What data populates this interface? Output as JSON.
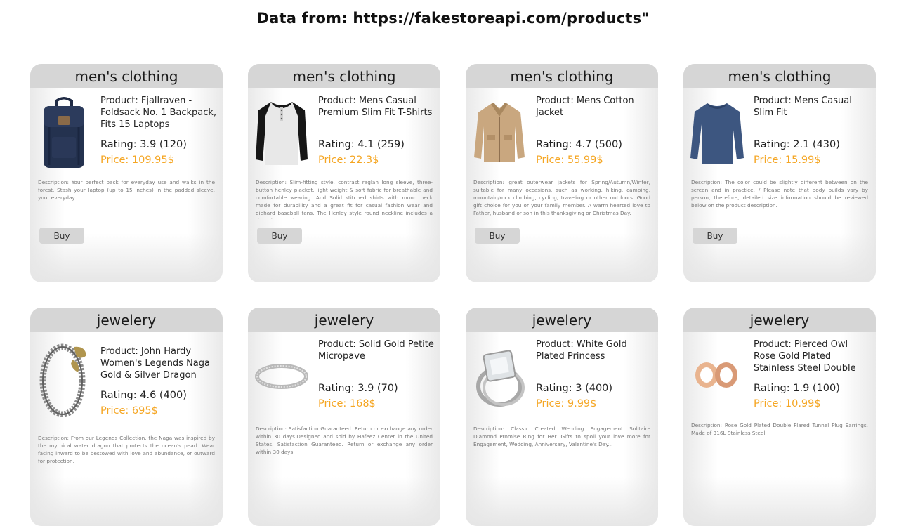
{
  "title": "Data from: https://fakestoreapi.com/products\"",
  "buy_label": "Buy",
  "products": [
    {
      "category": "men's clothing",
      "product": "Product: Fjallraven - Foldsack No. 1 Backpack, Fits 15 Laptops",
      "rating": "Rating: 3.9 (120)",
      "price": "Price: 109.95$",
      "description": "Description: Your perfect pack for everyday use and walks in the forest. Stash your laptop (up to 15 inches) in the padded sleeve, your everyday",
      "image_icon": "backpack-image"
    },
    {
      "category": "men's clothing",
      "product": "Product: Mens Casual Premium Slim Fit T-Shirts",
      "rating": "Rating: 4.1 (259)",
      "price": "Price: 22.3$",
      "description": "Description: Slim-fitting style, contrast raglan long sleeve, three-button henley placket, light weight & soft fabric for breathable and comfortable wearing. And Solid stitched shirts with round neck made for durability and a great fit for casual fashion wear and diehard baseball fans. The Henley style round neckline includes a three-button placket.",
      "image_icon": "henley-shirt-image"
    },
    {
      "category": "men's clothing",
      "product": "Product: Mens Cotton Jacket",
      "rating": "Rating: 4.7 (500)",
      "price": "Price: 55.99$",
      "description": "Description: great outerwear jackets for Spring/Autumn/Winter, suitable for many occasions, such as working, hiking, camping, mountain/rock climbing, cycling, traveling or other outdoors. Good gift choice for you or your family member. A warm hearted love to Father, husband or son in this thanksgiving or Christmas Day.",
      "image_icon": "jacket-image"
    },
    {
      "category": "men's clothing",
      "product": "Product: Mens Casual Slim Fit",
      "rating": "Rating: 2.1 (430)",
      "price": "Price: 15.99$",
      "description": "Description: The color could be slightly different between on the screen and in practice. / Please note that body builds vary by person, therefore, detailed size information should be reviewed below on the product description.",
      "image_icon": "long-sleeve-shirt-image"
    },
    {
      "category": "jewelery",
      "product": "Product: John Hardy Women's Legends Naga Gold & Silver Dragon",
      "rating": "Rating: 4.6 (400)",
      "price": "Price: 695$",
      "description": "Description: From our Legends Collection, the Naga was inspired by the mythical water dragon that protects the ocean's pearl. Wear facing inward to be bestowed with love and abundance, or outward for protection.",
      "image_icon": "dragon-bracelet-image"
    },
    {
      "category": "jewelery",
      "product": "Product: Solid Gold Petite Micropave",
      "rating": "Rating: 3.9 (70)",
      "price": "Price: 168$",
      "description": "Description: Satisfaction Guaranteed. Return or exchange any order within 30 days.Designed and sold by Hafeez Center in the United States. Satisfaction Guaranteed. Return or exchange any order within 30 days.",
      "image_icon": "micropave-ring-image"
    },
    {
      "category": "jewelery",
      "product": "Product: White Gold Plated Princess",
      "rating": "Rating: 3 (400)",
      "price": "Price: 9.99$",
      "description": "Description: Classic Created Wedding Engagement Solitaire Diamond Promise Ring for Her. Gifts to spoil your love more for Engagement, Wedding, Anniversary, Valentine's Day...",
      "image_icon": "princess-ring-image"
    },
    {
      "category": "jewelery",
      "product": "Product: Pierced Owl Rose Gold Plated Stainless Steel Double",
      "rating": "Rating: 1.9 (100)",
      "price": "Price: 10.99$",
      "description": "Description: Rose Gold Plated Double Flared Tunnel Plug Earrings. Made of 316L Stainless Steel",
      "image_icon": "tunnel-plug-earrings-image"
    }
  ]
}
